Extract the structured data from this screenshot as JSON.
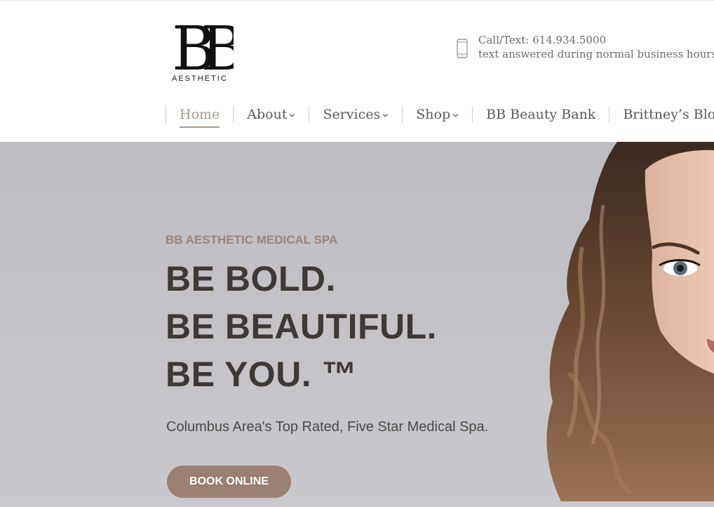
{
  "brand": {
    "logo_letters": "BB",
    "logo_subtitle": "AESTHETIC"
  },
  "contact": {
    "icon": "phone-icon",
    "line1": "Call/Text: 614.934.5000",
    "line2": "text answered during normal business hours"
  },
  "nav": {
    "items": [
      {
        "label": "Home",
        "active": true,
        "has_dropdown": false
      },
      {
        "label": "About",
        "active": false,
        "has_dropdown": true
      },
      {
        "label": "Services",
        "active": false,
        "has_dropdown": true
      },
      {
        "label": "Shop",
        "active": false,
        "has_dropdown": true
      },
      {
        "label": "BB Beauty Bank",
        "active": false,
        "has_dropdown": false
      },
      {
        "label": "Brittney’s Blog",
        "active": false,
        "has_dropdown": false
      }
    ]
  },
  "hero": {
    "eyebrow": "BB AESTHETIC MEDICAL SPA",
    "headline_1": "BE BOLD.",
    "headline_2": "BE BEAUTIFUL.",
    "headline_3": "BE YOU. ™",
    "tagline": "Columbus Area's Top Rated, Five Star Medical Spa.",
    "cta_label": "BOOK ONLINE"
  },
  "colors": {
    "accent": "#9a7f73",
    "eyebrow": "#9c857a",
    "nav_active": "#a8988c",
    "headline": "#3f3935",
    "hero_background": "#c2c1c6"
  }
}
